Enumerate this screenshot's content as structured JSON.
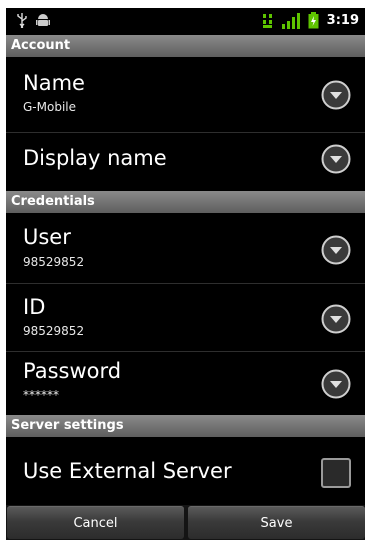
{
  "status_bar": {
    "time": "3:19",
    "icons": [
      "usb-icon",
      "android-debug-icon",
      "data-activity-icon",
      "signal-icon",
      "battery-icon"
    ]
  },
  "sections": {
    "account": {
      "header": "Account"
    },
    "credentials": {
      "header": "Credentials"
    },
    "server_settings": {
      "header": "Server settings"
    }
  },
  "rows": {
    "name": {
      "title": "Name",
      "value": "G-Mobile"
    },
    "display_name": {
      "title": "Display name"
    },
    "user": {
      "title": "User",
      "value": "98529852"
    },
    "id": {
      "title": "ID",
      "value": "98529852"
    },
    "password": {
      "title": "Password",
      "value": "******"
    },
    "use_external_server": {
      "title": "Use External Server",
      "checked": false
    }
  },
  "buttons": {
    "cancel": "Cancel",
    "save": "Save"
  },
  "colors": {
    "background": "#000000",
    "section_header": "#7a7a7a",
    "signal_green": "#5ec400",
    "text": "#ffffff"
  }
}
